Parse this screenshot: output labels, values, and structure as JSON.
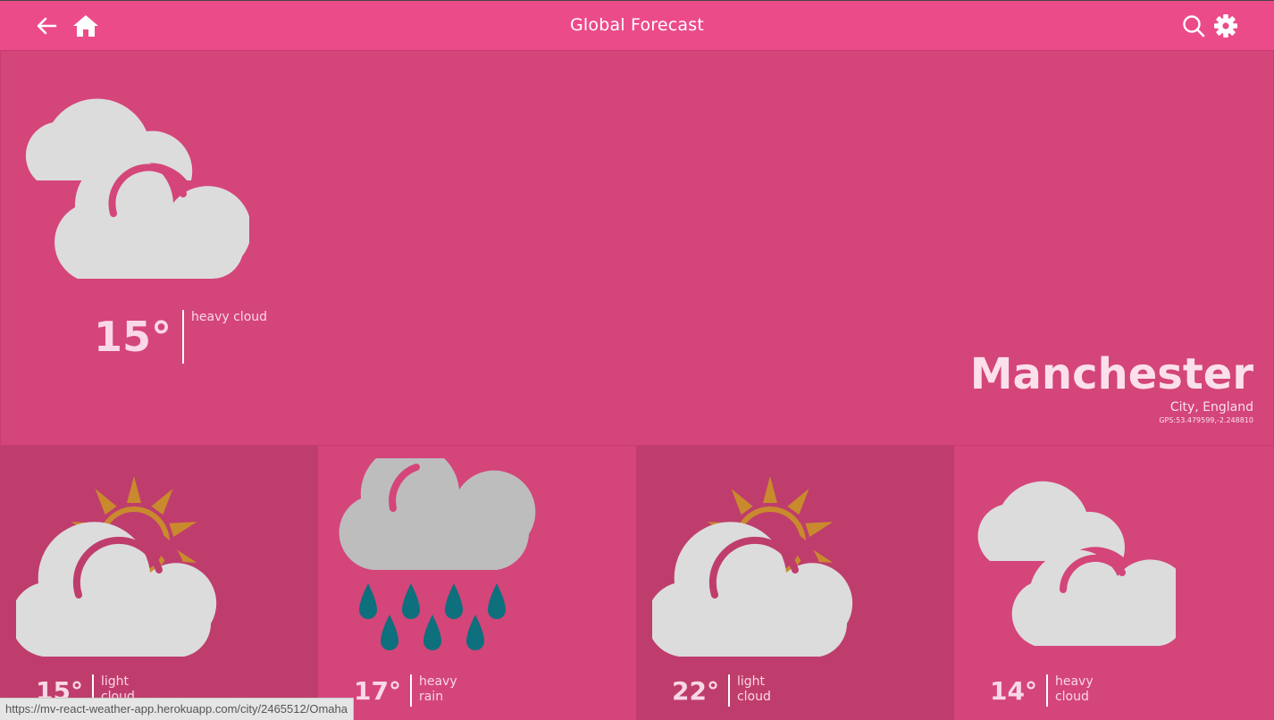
{
  "header": {
    "title": "Global Forecast",
    "back_icon": "arrow-left-icon",
    "home_icon": "home-icon",
    "search_icon": "search-icon",
    "settings_icon": "gear-icon"
  },
  "current": {
    "temperature": "15°",
    "condition": "heavy cloud",
    "icon": "heavy-cloud-icon",
    "city": "Manchester",
    "location_type": "City, England",
    "gps": "GPS:53.479599,-2.248810"
  },
  "forecast": [
    {
      "temperature": "15°",
      "condition": "light cloud",
      "icon": "light-cloud-icon"
    },
    {
      "temperature": "17°",
      "condition": "heavy rain",
      "icon": "heavy-rain-icon"
    },
    {
      "temperature": "22°",
      "condition": "light cloud",
      "icon": "light-cloud-icon"
    },
    {
      "temperature": "14°",
      "condition": "heavy cloud",
      "icon": "heavy-cloud-icon"
    }
  ],
  "status_url": "https://mv-react-weather-app.herokuapp.com/city/2465512/Omaha",
  "colors": {
    "header": "#ec4b8a",
    "background": "#d4457a",
    "tile_dark": "#bf3d6c",
    "cloud": "#dcdcdc",
    "rain_cloud": "#bdbdbd",
    "sun": "#c98a2e",
    "raindrop": "#0e6f7d"
  }
}
